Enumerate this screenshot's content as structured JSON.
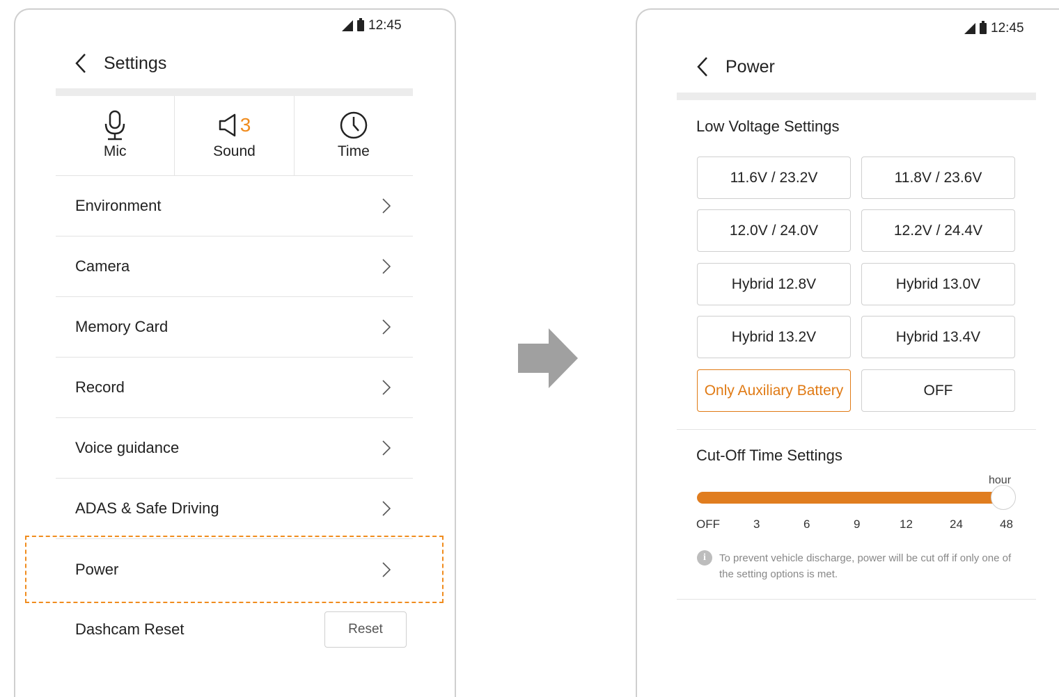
{
  "left_screen": {
    "status": {
      "time": "12:45"
    },
    "title": "Settings",
    "tiles": [
      {
        "icon": "mic-icon",
        "label": "Mic"
      },
      {
        "icon": "speaker-icon",
        "label": "Sound",
        "value": "3"
      },
      {
        "icon": "clock-icon",
        "label": "Time"
      }
    ],
    "menu": [
      {
        "label": "Environment"
      },
      {
        "label": "Camera"
      },
      {
        "label": "Memory Card"
      },
      {
        "label": "Record"
      },
      {
        "label": "Voice guidance"
      },
      {
        "label": "ADAS & Safe Driving"
      },
      {
        "label": "Power",
        "highlighted": true
      }
    ],
    "reset_row": {
      "label": "Dashcam Reset",
      "button": "Reset"
    }
  },
  "right_screen": {
    "status": {
      "time": "12:45"
    },
    "title": "Power",
    "low_voltage": {
      "title": "Low Voltage Settings",
      "options": [
        "11.6V / 23.2V",
        "11.8V / 23.6V",
        "12.0V / 24.0V",
        "12.2V / 24.4V",
        "Hybrid 12.8V",
        "Hybrid 13.0V",
        "Hybrid 13.2V",
        "Hybrid 13.4V",
        "Only Auxiliary Battery",
        "OFF"
      ],
      "selected": "Only Auxiliary Battery"
    },
    "cutoff": {
      "title": "Cut-Off Time Settings",
      "unit": "hour",
      "ticks": [
        "OFF",
        "3",
        "6",
        "9",
        "12",
        "24",
        "48"
      ],
      "selected": "48",
      "note": "To prevent vehicle discharge, power will be cut off if only one of the setting options is met."
    }
  },
  "colors": {
    "accent": "#e07d1f",
    "highlight_border": "#f08c1e",
    "divider": "#e3e3e3"
  }
}
